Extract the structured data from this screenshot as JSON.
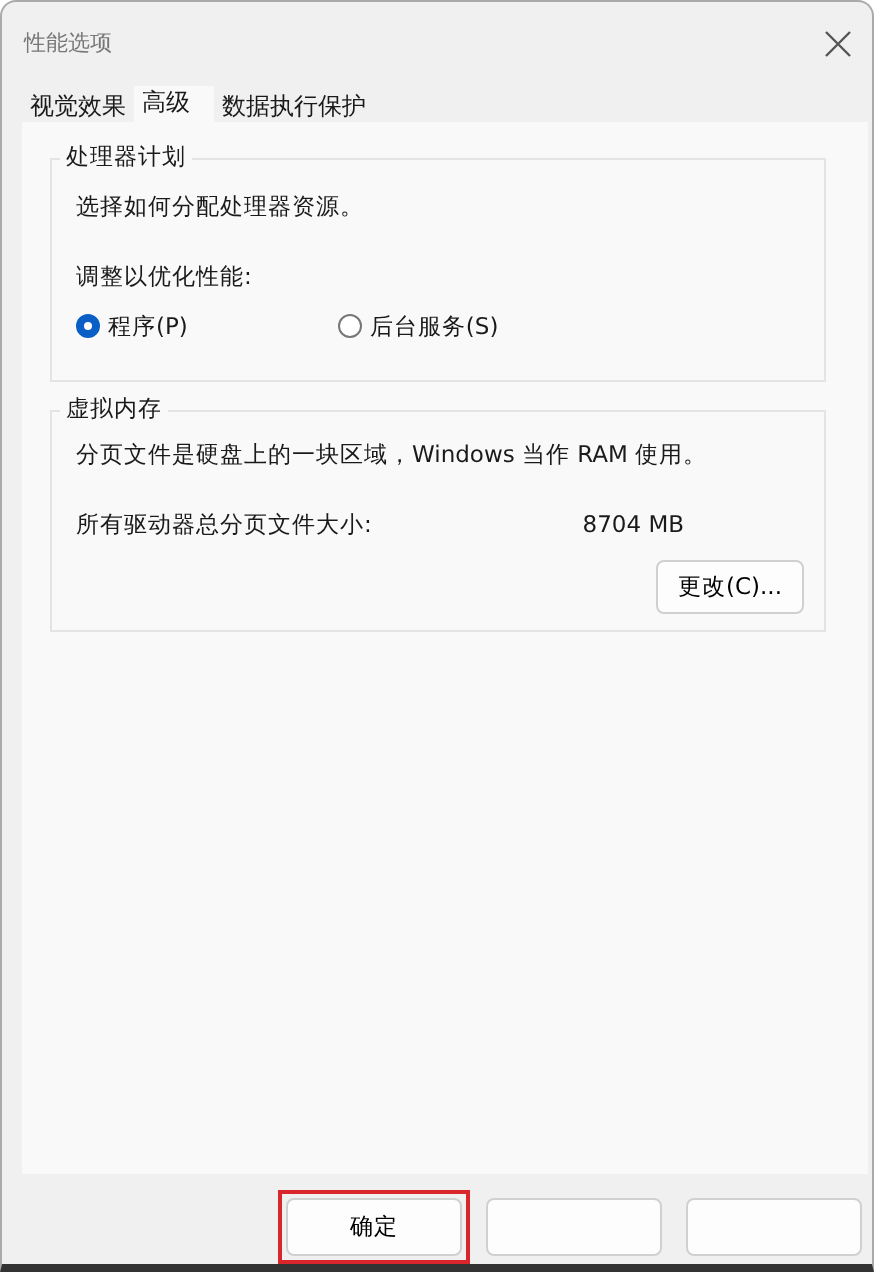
{
  "window": {
    "title": "性能选项"
  },
  "tabs": [
    {
      "label": "视觉效果",
      "selected": false
    },
    {
      "label": "高级",
      "selected": true
    },
    {
      "label": "数据执行保护",
      "selected": false
    }
  ],
  "processor_group": {
    "title": "处理器计划",
    "description": "选择如何分配处理器资源。",
    "prompt": "调整以优化性能:",
    "options": [
      {
        "label": "程序(P)",
        "selected": true
      },
      {
        "label": "后台服务(S)",
        "selected": false
      }
    ]
  },
  "memory_group": {
    "title": "虚拟内存",
    "description": "分页文件是硬盘上的一块区域，Windows 当作 RAM 使用。",
    "size_label": "所有驱动器总分页文件大小:",
    "size_value": "8704 MB",
    "button": "更改(C)..."
  },
  "buttons": [
    {
      "label": "确定",
      "highlighted": true
    },
    {
      "highlighted": false
    },
    {
      "highlighted": false
    }
  ]
}
